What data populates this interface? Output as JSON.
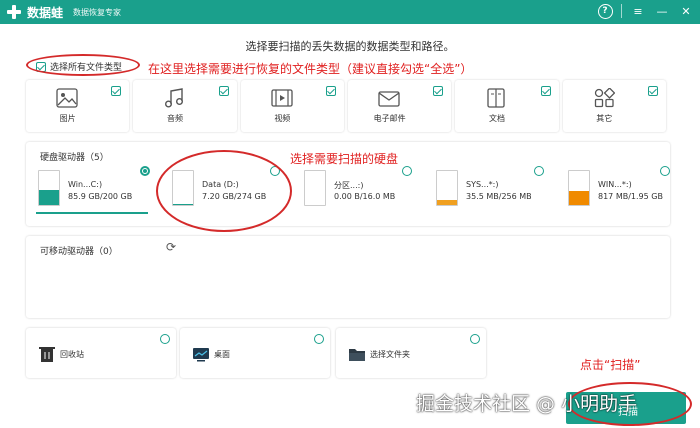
{
  "titlebar": {
    "app_name": "数据蛙",
    "subtitle": "数据恢复专家",
    "help_icon": "?",
    "menu_icon": "≡",
    "minimize_icon": "—",
    "close_icon": "✕"
  },
  "heading": "选择要扫描的丢失数据的数据类型和路径。",
  "select_all": {
    "label": "选择所有文件类型",
    "checked": true
  },
  "file_types": [
    {
      "label": "图片",
      "icon": "image-icon",
      "checked": true
    },
    {
      "label": "音频",
      "icon": "music-icon",
      "checked": true
    },
    {
      "label": "视频",
      "icon": "video-icon",
      "checked": true
    },
    {
      "label": "电子邮件",
      "icon": "mail-icon",
      "checked": true
    },
    {
      "label": "文档",
      "icon": "document-icon",
      "checked": true
    },
    {
      "label": "其它",
      "icon": "other-icon",
      "checked": true
    }
  ],
  "hard_drives": {
    "title": "硬盘驱动器（5）",
    "drives": [
      {
        "name": "Win...C:)",
        "size": "85.9 GB/200 GB",
        "used_fraction": 0.43,
        "fill_color": "#1aa08c",
        "selected": true
      },
      {
        "name": "Data (D:)",
        "size": "7.20 GB/274 GB",
        "used_fraction": 0.03,
        "fill_color": "#1aa08c",
        "selected": false
      },
      {
        "name": "分区...:)",
        "size": "0.00  B/16.0 MB",
        "used_fraction": 0.0,
        "fill_color": "#1aa08c",
        "selected": false
      },
      {
        "name": "SYS...*:)",
        "size": "35.5 MB/256 MB",
        "used_fraction": 0.14,
        "fill_color": "#f0a020",
        "selected": false
      },
      {
        "name": "WIN...*:)",
        "size": "817 MB/1.95 GB",
        "used_fraction": 0.42,
        "fill_color": "#f08a00",
        "selected": false
      }
    ]
  },
  "removable": {
    "title": "可移动驱动器（0）",
    "refresh_icon": "⟳"
  },
  "locations": [
    {
      "label": "回收站",
      "icon": "trash-icon"
    },
    {
      "label": "桌面",
      "icon": "desktop-icon"
    },
    {
      "label": "选择文件夹",
      "icon": "folder-icon"
    }
  ],
  "scan_button": {
    "label": "扫描"
  },
  "annotations": {
    "select_types": "在这里选择需要进行恢复的文件类型（建议直接勾选“全选”）",
    "select_drive": "选择需要扫描的硬盘",
    "click_scan": "点击“扫描”"
  },
  "watermark": "掘金技术社区 @ 小明助手",
  "colors": {
    "accent": "#1aa08c",
    "annotation": "#e02020"
  }
}
